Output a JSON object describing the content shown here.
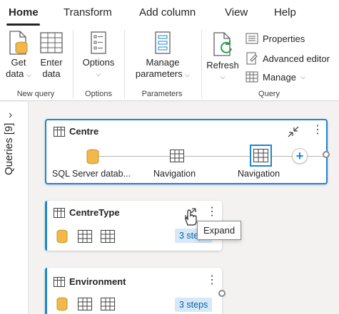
{
  "ribbon_tabs": [
    {
      "label": "Home",
      "active": true
    },
    {
      "label": "Transform"
    },
    {
      "label": "Add column"
    },
    {
      "label": "View"
    },
    {
      "label": "Help"
    }
  ],
  "ribbon": {
    "get_data": "Get\ndata",
    "enter_data": "Enter\ndata",
    "new_query_group": "New query",
    "options": "Options",
    "options_group": "Options",
    "manage_parameters": "Manage\nparameters",
    "parameters_group": "Parameters",
    "refresh": "Refresh",
    "properties": "Properties",
    "advanced_editor": "Advanced editor",
    "manage": "Manage",
    "query_group": "Query"
  },
  "sidebar": {
    "label": "Queries [9]"
  },
  "queries": [
    {
      "name": "Centre",
      "steps": [
        "SQL Server datab...",
        "Navigation",
        "Navigation"
      ]
    },
    {
      "name": "CentreType",
      "steps_badge": "3 steps"
    },
    {
      "name": "Environment",
      "steps_badge": "3 steps"
    }
  ],
  "tooltip": "Expand",
  "colors": {
    "accent": "#1a86d6",
    "badge_bg": "#d6e9f8",
    "db_icon": "#f2b84b"
  }
}
